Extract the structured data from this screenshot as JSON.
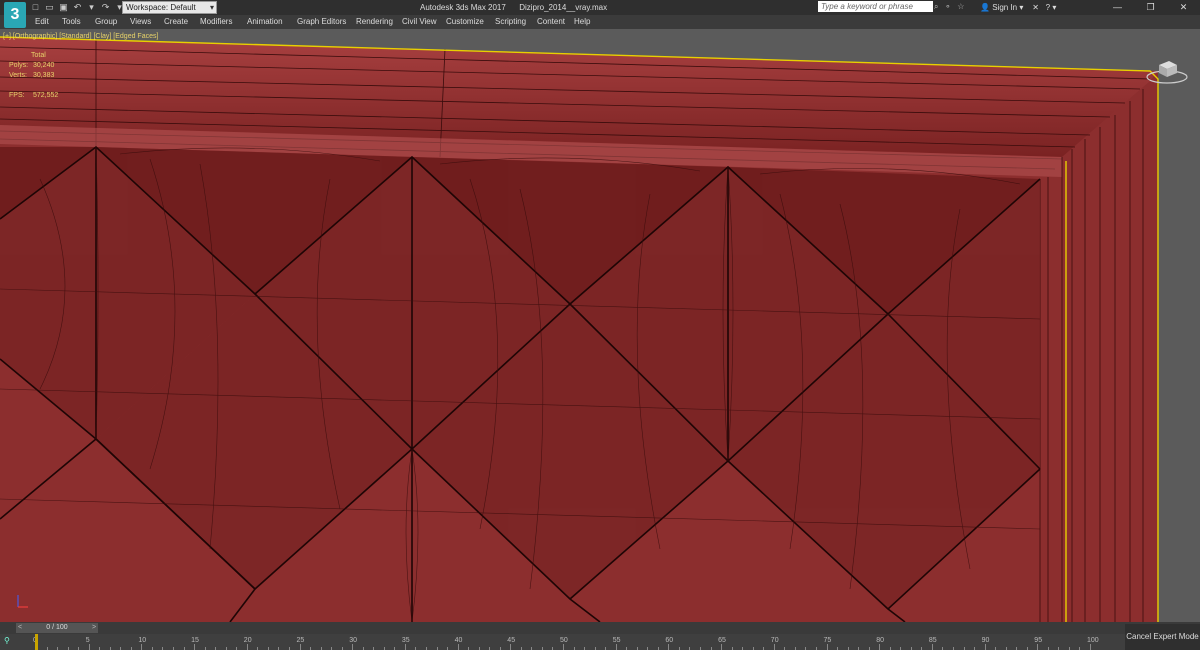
{
  "app": {
    "logo": "3",
    "title": "Autodesk 3ds Max 2017",
    "filename": "Dizipro_2014__vray.max",
    "workspace": "Workspace: Default",
    "search_placeholder": "Type a keyword or phrase",
    "sign_in": "Sign In"
  },
  "menu": [
    "Edit",
    "Tools",
    "Group",
    "Views",
    "Create",
    "Modifiers",
    "Animation",
    "Graph Editors",
    "Rendering",
    "Civil View",
    "Customize",
    "Scripting",
    "Content",
    "Help"
  ],
  "viewport": {
    "label": "[+] [Orthographic] [Standard] [Clay] [Edged Faces]",
    "stats": {
      "header": "Total",
      "polys_label": "Polys:",
      "polys": "30,240",
      "verts_label": "Verts:",
      "verts": "30,383",
      "fps_label": "FPS:",
      "fps": "572,552"
    }
  },
  "timeline": {
    "frame": "0 / 100",
    "ticks": [
      "0",
      "5",
      "10",
      "15",
      "20",
      "25",
      "30",
      "35",
      "40",
      "45",
      "50",
      "55",
      "60",
      "65",
      "70",
      "75",
      "80",
      "85",
      "90",
      "95",
      "100"
    ],
    "cancel_label": "Cancel Expert Mode"
  },
  "colors": {
    "surface": "#8a2b2b",
    "surface_light": "#a04040",
    "edge": "#2a0808",
    "selection": "#e8d000"
  }
}
